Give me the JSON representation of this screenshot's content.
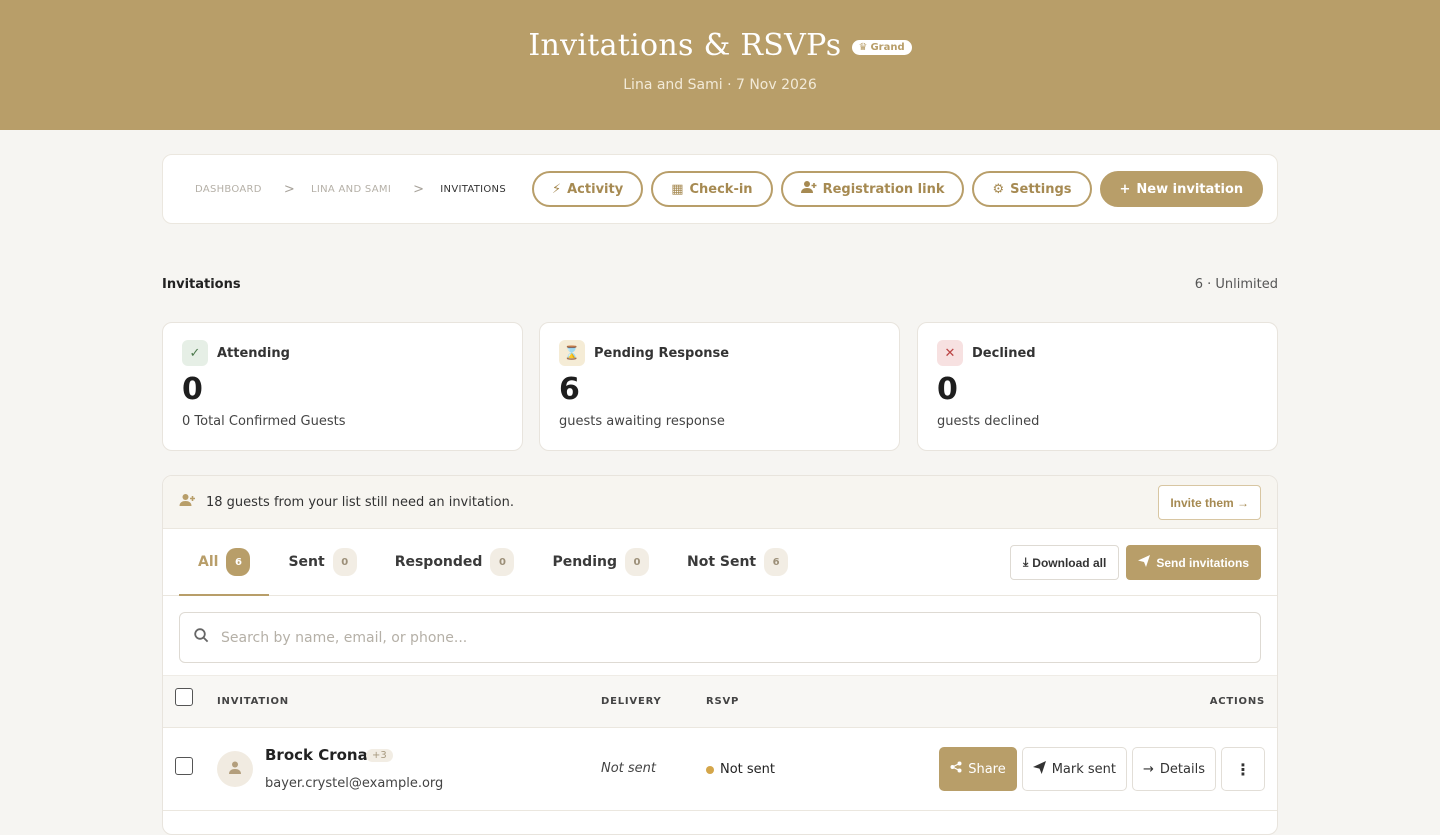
{
  "hero": {
    "title": "Invitations & RSVPs",
    "plan_badge": "Grand",
    "subtitle": "Lina and Sami · 7 Nov 2026"
  },
  "breadcrumb": [
    "DASHBOARD",
    "LINA AND SAMI",
    "INVITATIONS"
  ],
  "breadcrumb_sep": ">",
  "toolbar": {
    "activity": "Activity",
    "checkin": "Check-in",
    "registration": "Registration link",
    "settings": "Settings",
    "new_invitation": "New invitation"
  },
  "section": {
    "title": "Invitations",
    "count": "6 · Unlimited"
  },
  "stats": [
    {
      "label": "Attending",
      "value": "0",
      "desc": "0 Total Confirmed Guests",
      "icon": "check-icon"
    },
    {
      "label": "Pending Response",
      "value": "6",
      "desc": "guests awaiting response",
      "icon": "hourglass-icon"
    },
    {
      "label": "Declined",
      "value": "0",
      "desc": "guests declined",
      "icon": "x-icon"
    }
  ],
  "notice": {
    "text": "18 guests from your list still need an invitation.",
    "button": "Invite them →"
  },
  "tabs": [
    {
      "label": "All",
      "count": "6"
    },
    {
      "label": "Sent",
      "count": "0"
    },
    {
      "label": "Responded",
      "count": "0"
    },
    {
      "label": "Pending",
      "count": "0"
    },
    {
      "label": "Not Sent",
      "count": "6"
    }
  ],
  "tab_actions": {
    "download": "Download all",
    "send": "Send invitations"
  },
  "search": {
    "placeholder": "Search by name, email, or phone..."
  },
  "table": {
    "headers": {
      "invitation": "INVITATION",
      "delivery": "DELIVERY",
      "rsvp": "RSVP",
      "actions": "ACTIONS"
    },
    "rows": [
      {
        "name": "Brock Crona",
        "extra": "+3",
        "email": "bayer.crystel@example.org",
        "delivery": "Not sent",
        "rsvp": "Not sent"
      }
    ],
    "row_actions": {
      "share": "Share",
      "mark_sent": "Mark sent",
      "details": "Details",
      "more": "⋮"
    }
  },
  "colors": {
    "brand": "#b89e69",
    "pending_dot": "#d4a64a",
    "attending_bg": "#e6efe6",
    "pending_bg": "#f5ecd6",
    "declined_bg": "#f7e1e1"
  }
}
